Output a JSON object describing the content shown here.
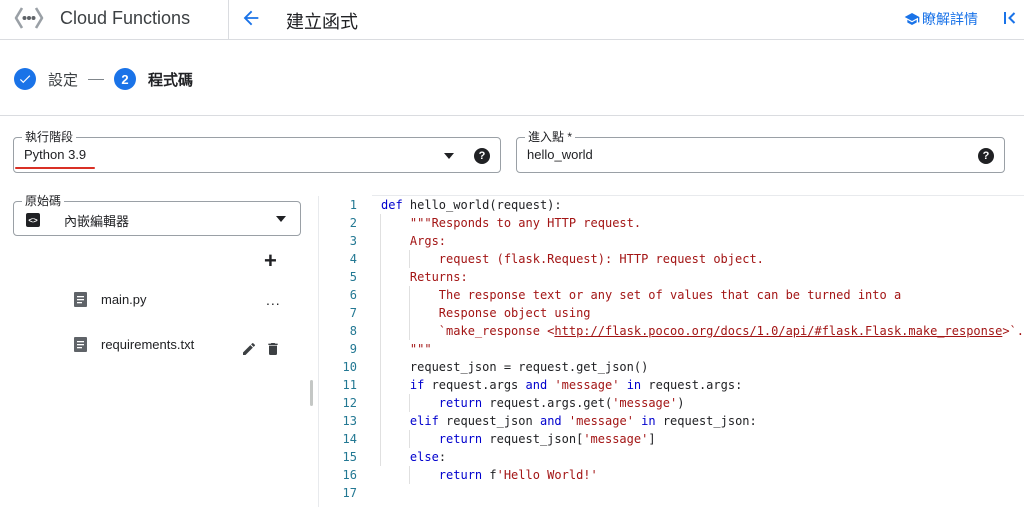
{
  "header": {
    "app_name": "Cloud Functions",
    "page_title": "建立函式",
    "learn_more": "瞭解詳情"
  },
  "stepper": {
    "steps": [
      {
        "number": "1",
        "label": "設定",
        "state": "completed"
      },
      {
        "number": "2",
        "label": "程式碼",
        "state": "active"
      }
    ]
  },
  "runtime": {
    "label": "執行階段",
    "value": "Python 3.9"
  },
  "entry_point": {
    "label": "進入點 *",
    "value": "hello_world"
  },
  "source": {
    "label": "原始碼",
    "value": "內嵌編輯器",
    "files": [
      {
        "name": "main.py"
      },
      {
        "name": "requirements.txt"
      }
    ],
    "more_label": "..."
  },
  "editor": {
    "line_numbers": [
      "1",
      "2",
      "3",
      "4",
      "5",
      "6",
      "7",
      "8",
      "9",
      "10",
      "11",
      "12",
      "13",
      "14",
      "15",
      "16",
      "17"
    ],
    "lines": [
      [
        {
          "t": "kw",
          "s": "def"
        },
        {
          "t": "",
          "s": " hello_world(request):"
        }
      ],
      [
        {
          "t": "",
          "s": "    "
        },
        {
          "t": "str",
          "s": "\"\"\"Responds to any HTTP request."
        }
      ],
      [
        {
          "t": "",
          "s": "    "
        },
        {
          "t": "str",
          "s": "Args:"
        }
      ],
      [
        {
          "t": "",
          "s": "        "
        },
        {
          "t": "str",
          "s": "request (flask.Request): HTTP request object."
        }
      ],
      [
        {
          "t": "",
          "s": "    "
        },
        {
          "t": "str",
          "s": "Returns:"
        }
      ],
      [
        {
          "t": "",
          "s": "        "
        },
        {
          "t": "str",
          "s": "The response text or any set of values that can be turned into a"
        }
      ],
      [
        {
          "t": "",
          "s": "        "
        },
        {
          "t": "str",
          "s": "Response object using"
        }
      ],
      [
        {
          "t": "",
          "s": "        "
        },
        {
          "t": "str",
          "s": "`make_response <"
        },
        {
          "t": "str link",
          "s": "http://flask.pocoo.org/docs/1.0/api/#flask.Flask.make_response"
        },
        {
          "t": "str",
          "s": ">`."
        }
      ],
      [
        {
          "t": "",
          "s": "    "
        },
        {
          "t": "str",
          "s": "\"\"\""
        }
      ],
      [
        {
          "t": "",
          "s": "    request_json = request.get_json()"
        }
      ],
      [
        {
          "t": "",
          "s": "    "
        },
        {
          "t": "kw",
          "s": "if"
        },
        {
          "t": "",
          "s": " request.args "
        },
        {
          "t": "kw",
          "s": "and"
        },
        {
          "t": "",
          "s": " "
        },
        {
          "t": "str",
          "s": "'message'"
        },
        {
          "t": "",
          "s": " "
        },
        {
          "t": "kw",
          "s": "in"
        },
        {
          "t": "",
          "s": " request.args:"
        }
      ],
      [
        {
          "t": "",
          "s": "        "
        },
        {
          "t": "kw",
          "s": "return"
        },
        {
          "t": "",
          "s": " request.args.get("
        },
        {
          "t": "str",
          "s": "'message'"
        },
        {
          "t": "",
          "s": ")"
        }
      ],
      [
        {
          "t": "",
          "s": "    "
        },
        {
          "t": "kw",
          "s": "elif"
        },
        {
          "t": "",
          "s": " request_json "
        },
        {
          "t": "kw",
          "s": "and"
        },
        {
          "t": "",
          "s": " "
        },
        {
          "t": "str",
          "s": "'message'"
        },
        {
          "t": "",
          "s": " "
        },
        {
          "t": "kw",
          "s": "in"
        },
        {
          "t": "",
          "s": " request_json:"
        }
      ],
      [
        {
          "t": "",
          "s": "        "
        },
        {
          "t": "kw",
          "s": "return"
        },
        {
          "t": "",
          "s": " request_json["
        },
        {
          "t": "str",
          "s": "'message'"
        },
        {
          "t": "",
          "s": "]"
        }
      ],
      [
        {
          "t": "",
          "s": "    "
        },
        {
          "t": "kw",
          "s": "else"
        },
        {
          "t": "",
          "s": ":"
        }
      ],
      [
        {
          "t": "",
          "s": "        "
        },
        {
          "t": "kw",
          "s": "return"
        },
        {
          "t": "",
          "s": " f"
        },
        {
          "t": "str",
          "s": "'Hello World!'"
        }
      ],
      [
        {
          "t": "",
          "s": ""
        }
      ]
    ]
  },
  "colors": {
    "accent": "#1a73e8",
    "keyword": "#0000cd",
    "string": "#a31515",
    "line_number": "#237893",
    "highlight_underline": "#d93025"
  }
}
